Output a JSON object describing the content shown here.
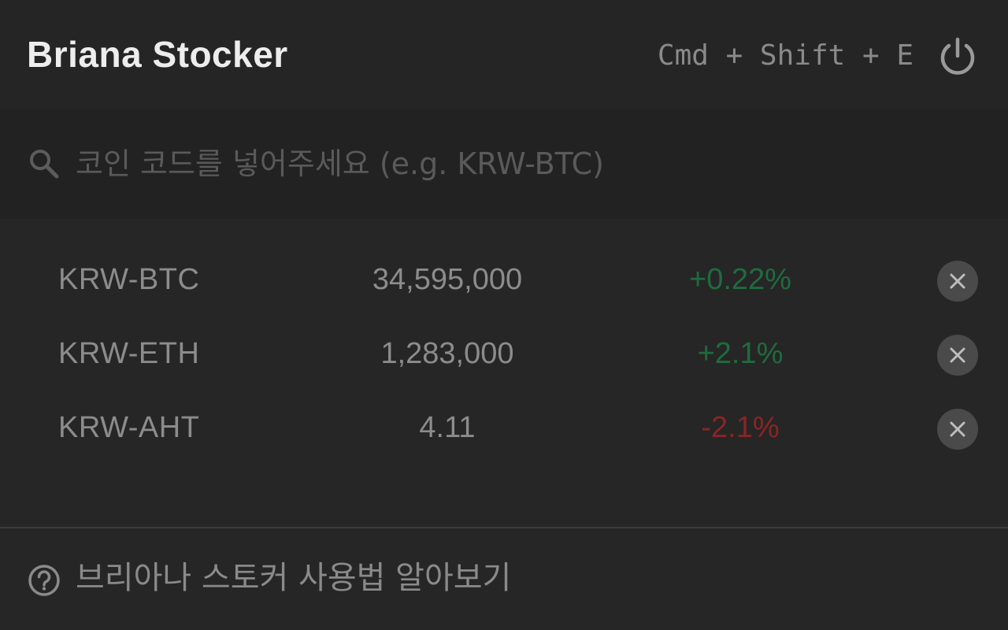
{
  "header": {
    "title": "Briana Stocker",
    "shortcut": "Cmd + Shift + E",
    "power_icon": "power-icon"
  },
  "search": {
    "placeholder": "코인 코드를 넣어주세요 (e.g. KRW-BTC)",
    "value": "",
    "icon": "search-icon"
  },
  "coins": [
    {
      "code": "KRW-BTC",
      "price": "34,595,000",
      "change": "+0.22%",
      "direction": "up"
    },
    {
      "code": "KRW-ETH",
      "price": "1,283,000",
      "change": "+2.1%",
      "direction": "up"
    },
    {
      "code": "KRW-AHT",
      "price": "4.11",
      "change": "-2.1%",
      "direction": "down"
    }
  ],
  "footer": {
    "help_label": "브리아나 스토커 사용법 알아보기",
    "help_icon": "question-circle-icon"
  },
  "colors": {
    "background": "#262626",
    "header_bg": "#252525",
    "search_bg": "#222222",
    "up": "#1f6b3f",
    "down": "#8c2424",
    "text_muted": "#8c8c8c",
    "title": "#ededed"
  }
}
